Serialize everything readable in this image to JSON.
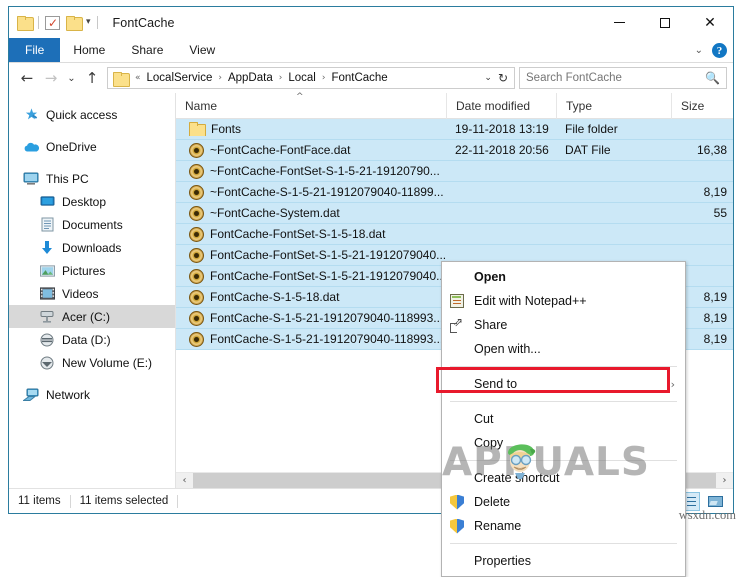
{
  "window": {
    "title": "FontCache",
    "quick_access": {
      "folder_icon": "folder-icon",
      "properties_icon": "properties-checkbox-icon",
      "new_folder_icon": "new-folder-icon",
      "customize_caret": "▾"
    },
    "controls": {
      "minimize": "—",
      "maximize": "▢",
      "close": "✕"
    }
  },
  "ribbon": {
    "tabs": [
      {
        "label": "File",
        "active": true
      },
      {
        "label": "Home",
        "active": false
      },
      {
        "label": "Share",
        "active": false
      },
      {
        "label": "View",
        "active": false
      }
    ],
    "expand_caret": "⌄",
    "help_label": "?"
  },
  "address": {
    "back": "←",
    "forward": "→",
    "recent_caret": "⌄",
    "up": "↑",
    "folder_icon": "folder-icon",
    "prefix": "«",
    "crumbs": [
      "LocalService",
      "AppData",
      "Local",
      "FontCache"
    ],
    "separator": "›",
    "dropdown_caret": "⌄",
    "refresh": "↻",
    "search_placeholder": "Search FontCache",
    "search_value": "",
    "search_icon": "🔍"
  },
  "nav_pane": {
    "items": [
      {
        "label": "Quick access",
        "icon": "star-pin-icon",
        "indent": false,
        "selected": false
      },
      {
        "label": "OneDrive",
        "icon": "cloud-icon",
        "indent": false,
        "selected": false
      },
      {
        "label": "This PC",
        "icon": "monitor-icon",
        "indent": false,
        "selected": false
      },
      {
        "label": "Desktop",
        "icon": "desktop-icon",
        "indent": true,
        "selected": false
      },
      {
        "label": "Documents",
        "icon": "documents-icon",
        "indent": true,
        "selected": false
      },
      {
        "label": "Downloads",
        "icon": "download-arrow-icon",
        "indent": true,
        "selected": false
      },
      {
        "label": "Pictures",
        "icon": "pictures-icon",
        "indent": true,
        "selected": false
      },
      {
        "label": "Videos",
        "icon": "videos-icon",
        "indent": true,
        "selected": false
      },
      {
        "label": "Acer (C:)",
        "icon": "hard-drive-icon",
        "indent": true,
        "selected": true
      },
      {
        "label": "Data (D:)",
        "icon": "hard-drive-icon",
        "indent": true,
        "selected": false
      },
      {
        "label": "New Volume (E:)",
        "icon": "hard-drive-icon",
        "indent": true,
        "selected": false
      },
      {
        "label": "Network",
        "icon": "network-icon",
        "indent": false,
        "selected": false
      }
    ]
  },
  "columns": [
    {
      "label": "Name",
      "sorted": true,
      "sort_caret": "^"
    },
    {
      "label": "Date modified",
      "sorted": false
    },
    {
      "label": "Type",
      "sorted": false
    },
    {
      "label": "Size",
      "sorted": false
    }
  ],
  "files": [
    {
      "name": "Fonts",
      "icon": "folder-icon",
      "date": "19-11-2018 13:19",
      "type": "File folder",
      "size": "",
      "selected": true
    },
    {
      "name": "~FontCache-FontFace.dat",
      "icon": "dat-file-icon",
      "date": "22-11-2018 20:56",
      "type": "DAT File",
      "size": "16,38",
      "selected": true
    },
    {
      "name": "~FontCache-FontSet-S-1-5-21-19120790...",
      "icon": "dat-file-icon",
      "date": "",
      "type": "",
      "size": "",
      "selected": true
    },
    {
      "name": "~FontCache-S-1-5-21-1912079040-11899...",
      "icon": "dat-file-icon",
      "date": "",
      "type": "",
      "size": "8,19",
      "selected": true
    },
    {
      "name": "~FontCache-System.dat",
      "icon": "dat-file-icon",
      "date": "",
      "type": "",
      "size": "55",
      "selected": true
    },
    {
      "name": "FontCache-FontSet-S-1-5-18.dat",
      "icon": "dat-file-icon",
      "date": "",
      "type": "",
      "size": "",
      "selected": true
    },
    {
      "name": "FontCache-FontSet-S-1-5-21-1912079040...",
      "icon": "dat-file-icon",
      "date": "",
      "type": "",
      "size": "",
      "selected": true
    },
    {
      "name": "FontCache-FontSet-S-1-5-21-1912079040...",
      "icon": "dat-file-icon",
      "date": "",
      "type": "",
      "size": "",
      "selected": true
    },
    {
      "name": "FontCache-S-1-5-18.dat",
      "icon": "dat-file-icon",
      "date": "",
      "type": "",
      "size": "8,19",
      "selected": true
    },
    {
      "name": "FontCache-S-1-5-21-1912079040-118993...",
      "icon": "dat-file-icon",
      "date": "",
      "type": "",
      "size": "8,19",
      "selected": true
    },
    {
      "name": "FontCache-S-1-5-21-1912079040-118993...",
      "icon": "dat-file-icon",
      "date": "",
      "type": "",
      "size": "8,19",
      "selected": true
    }
  ],
  "context_menu": {
    "highlighted_item": "Delete",
    "highlight_color": "#e8192c",
    "items": [
      {
        "label": "Open",
        "icon": "",
        "bold": true,
        "accel": "O",
        "submenu": false,
        "sep_after": false
      },
      {
        "label": "Edit with Notepad++",
        "icon": "notepadpp-icon",
        "bold": false,
        "accel": "N",
        "submenu": false,
        "sep_after": false
      },
      {
        "label": "Share",
        "icon": "share-icon",
        "bold": false,
        "accel": "",
        "submenu": false,
        "sep_after": false
      },
      {
        "label": "Open with...",
        "icon": "",
        "bold": false,
        "accel": "h",
        "submenu": false,
        "sep_after": true
      },
      {
        "label": "Send to",
        "icon": "",
        "bold": false,
        "accel": "n",
        "submenu": true,
        "sep_after": true
      },
      {
        "label": "Cut",
        "icon": "",
        "bold": false,
        "accel": "t",
        "submenu": false,
        "sep_after": false
      },
      {
        "label": "Copy",
        "icon": "",
        "bold": false,
        "accel": "C",
        "submenu": false,
        "sep_after": true
      },
      {
        "label": "Create shortcut",
        "icon": "",
        "bold": false,
        "accel": "s",
        "submenu": false,
        "sep_after": false
      },
      {
        "label": "Delete",
        "icon": "shield-icon",
        "bold": false,
        "accel": "D",
        "submenu": false,
        "sep_after": false
      },
      {
        "label": "Rename",
        "icon": "shield-icon",
        "bold": false,
        "accel": "m",
        "submenu": false,
        "sep_after": true
      },
      {
        "label": "Properties",
        "icon": "",
        "bold": false,
        "accel": "r",
        "submenu": false,
        "sep_after": false
      }
    ],
    "submenu_arrow": "›"
  },
  "hscroll": {
    "left_arrow": "‹",
    "right_arrow": "›"
  },
  "status": {
    "item_count": "11 items",
    "selection": "11 items selected"
  },
  "view_buttons": [
    {
      "name": "details-view",
      "active": true
    },
    {
      "name": "large-icons-view",
      "active": false
    }
  ],
  "watermarks": {
    "brand": "APPUALS",
    "site": "wsxdn.com"
  },
  "colors": {
    "accent": "#1d6fb8",
    "selection": "#cce8f7",
    "highlight_border": "#e8192c",
    "window_border": "#2b7c9e"
  }
}
